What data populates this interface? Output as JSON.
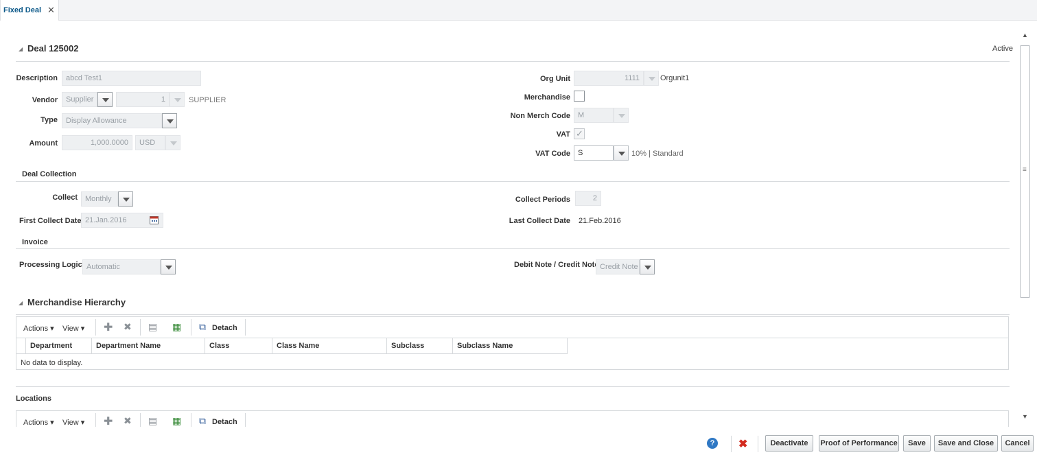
{
  "tabs": [
    {
      "label": "Fixed Deal",
      "close_icon": "close-icon"
    }
  ],
  "deal": {
    "title": "Deal 125002",
    "status": "Active",
    "description_label": "Description",
    "description_value": "abcd Test1",
    "vendor_label": "Vendor",
    "vendor_type": "Supplier",
    "vendor_number": "1",
    "vendor_name": "SUPPLIER",
    "type_label": "Type",
    "type_value": "Display Allowance",
    "amount_label": "Amount",
    "amount_value": "1,000.0000",
    "currency_value": "USD",
    "org_unit_label": "Org Unit",
    "org_unit_value": "1111",
    "org_unit_name": "Orgunit1",
    "merchandise_label": "Merchandise",
    "merchandise_checked": false,
    "non_merch_label": "Non Merch Code",
    "non_merch_value": "M",
    "vat_label": "VAT",
    "vat_checked": true,
    "vat_code_label": "VAT Code",
    "vat_code_value": "S",
    "vat_rate_text": "10% | Standard"
  },
  "deal_collection": {
    "title": "Deal Collection",
    "collect_label": "Collect",
    "collect_value": "Monthly",
    "first_collect_label": "First Collect Date",
    "first_collect_value": "21.Jan.2016",
    "collect_periods_label": "Collect Periods",
    "collect_periods_value": "2",
    "last_collect_label": "Last Collect Date",
    "last_collect_value": "21.Feb.2016"
  },
  "invoice": {
    "title": "Invoice",
    "processing_label": "Processing Logic",
    "processing_value": "Automatic",
    "debit_credit_label": "Debit Note / Credit Note",
    "debit_credit_value": "Credit Note"
  },
  "merch_hierarchy": {
    "title": "Merchandise Hierarchy",
    "toolbar": {
      "actions": "Actions",
      "view": "View",
      "detach": "Detach"
    },
    "columns": [
      "Department",
      "Department Name",
      "Class",
      "Class Name",
      "Subclass",
      "Subclass Name"
    ],
    "empty_text": "No data to display."
  },
  "locations": {
    "title": "Locations",
    "toolbar": {
      "actions": "Actions",
      "view": "View",
      "detach": "Detach"
    }
  },
  "footer": {
    "help_icon": "help-icon",
    "discard_icon": "delete-x-icon",
    "buttons": [
      "Deactivate",
      "Proof of Performance",
      "Save",
      "Save and Close",
      "Cancel"
    ]
  },
  "colors": {
    "accent": "#0e5a8a",
    "discard_red": "#d32a1e",
    "help_blue": "#2f78c4"
  }
}
